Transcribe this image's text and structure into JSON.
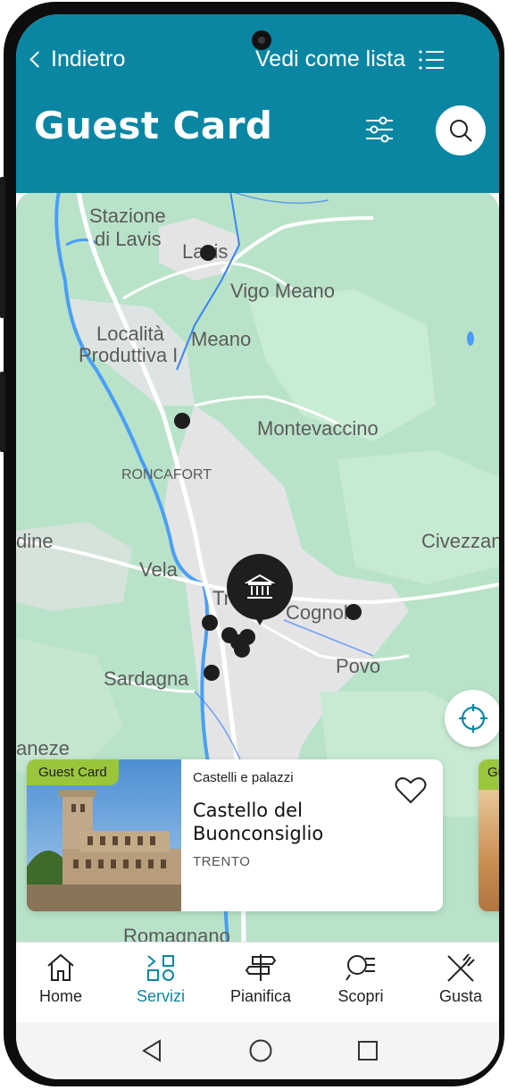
{
  "header": {
    "back_label": "Indietro",
    "list_label": "Vedi come lista",
    "title": "Guest Card",
    "accent_color": "#0a86a3"
  },
  "map": {
    "labels": [
      {
        "text": "Stazione"
      },
      {
        "text": "di Lavis"
      },
      {
        "text": "Lavis"
      },
      {
        "text": "Vigo Meano"
      },
      {
        "text": "Località"
      },
      {
        "text": "Produttiva I"
      },
      {
        "text": "Meano"
      },
      {
        "text": "Montevaccino"
      },
      {
        "text": "RONCAFORT"
      },
      {
        "text": "dine"
      },
      {
        "text": "Civezzan"
      },
      {
        "text": "Vela"
      },
      {
        "text": "Tr"
      },
      {
        "text": "Cognol"
      },
      {
        "text": "Povo"
      },
      {
        "text": "Sardagna"
      },
      {
        "text": "aneze"
      },
      {
        "text": "Romagnano"
      }
    ],
    "marker_icon": "museum-icon"
  },
  "card": {
    "badge": "Guest Card",
    "category": "Castelli e palazzi",
    "title": "Castello del Buonconsiglio",
    "city": "TRENTO",
    "badge_color": "#9bc53d"
  },
  "card_next": {
    "badge": "Gu"
  },
  "tabs": [
    {
      "label": "Home",
      "icon": "home-icon"
    },
    {
      "label": "Servizi",
      "icon": "services-icon",
      "active": true
    },
    {
      "label": "Pianifica",
      "icon": "signpost-icon"
    },
    {
      "label": "Scopri",
      "icon": "discover-icon"
    },
    {
      "label": "Gusta",
      "icon": "cutlery-icon"
    }
  ]
}
